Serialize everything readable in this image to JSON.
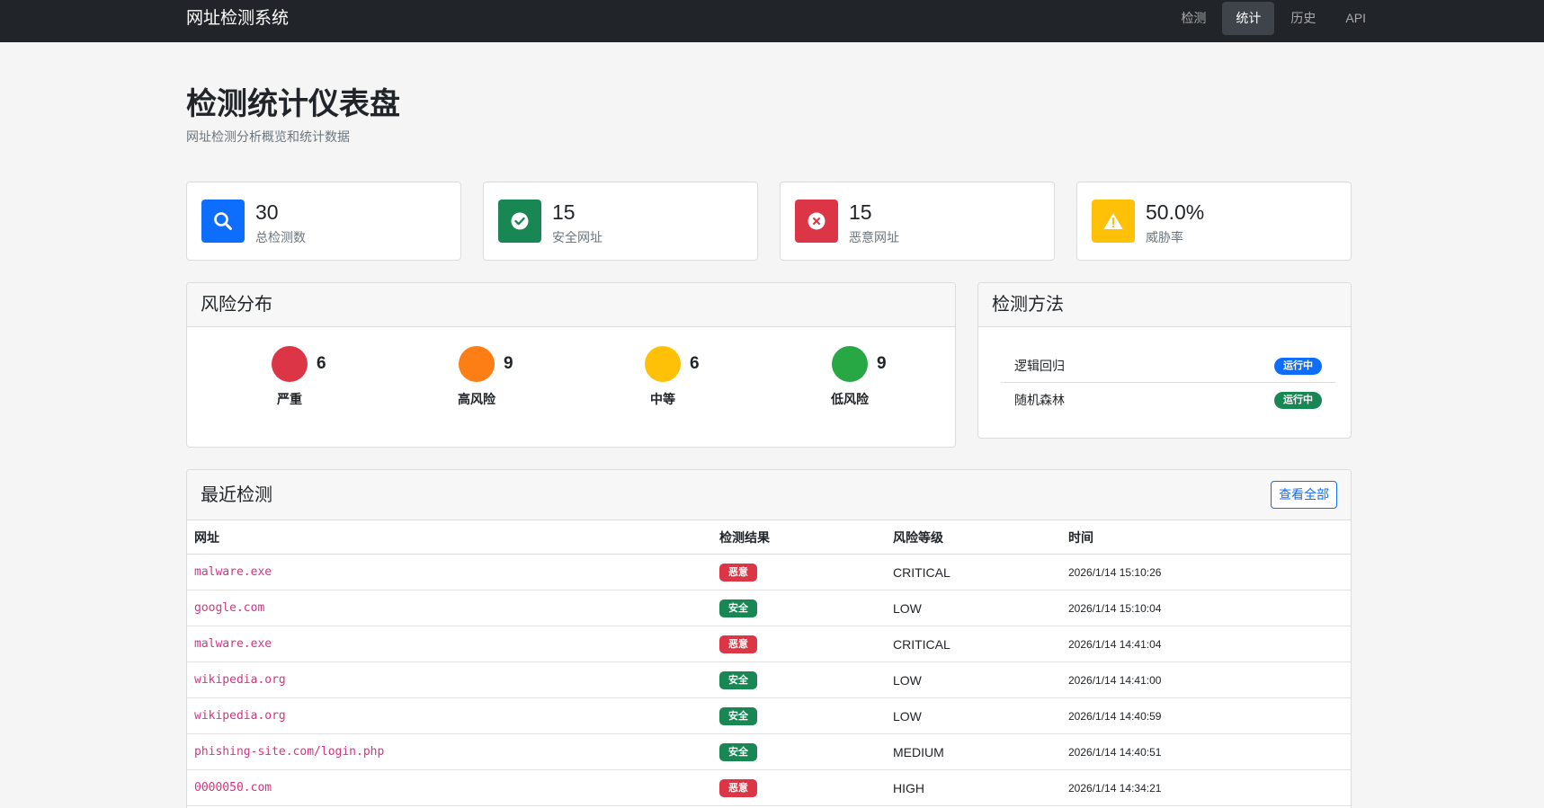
{
  "navbar": {
    "brand": "网址检测系统",
    "items": [
      {
        "label": "检测",
        "active": false
      },
      {
        "label": "统计",
        "active": true
      },
      {
        "label": "历史",
        "active": false
      },
      {
        "label": "API",
        "active": false
      }
    ]
  },
  "header": {
    "title": "检测统计仪表盘",
    "subtitle": "网址检测分析概览和统计数据"
  },
  "stats": [
    {
      "value": "30",
      "label": "总检测数",
      "icon": "search-icon",
      "color": "#0d6efd"
    },
    {
      "value": "15",
      "label": "安全网址",
      "icon": "check-circle-icon",
      "color": "#198754"
    },
    {
      "value": "15",
      "label": "恶意网址",
      "icon": "x-circle-icon",
      "color": "#dc3545"
    },
    {
      "value": "50.0%",
      "label": "威胁率",
      "icon": "warning-icon",
      "color": "#ffc107"
    }
  ],
  "risk": {
    "title": "风险分布",
    "items": [
      {
        "count": "6",
        "label": "严重",
        "color": "#dc3545"
      },
      {
        "count": "9",
        "label": "高风险",
        "color": "#fd7e14"
      },
      {
        "count": "6",
        "label": "中等",
        "color": "#ffc107"
      },
      {
        "count": "9",
        "label": "低风险",
        "color": "#28a745"
      }
    ]
  },
  "methods": {
    "title": "检测方法",
    "items": [
      {
        "name": "逻辑回归",
        "status": "运行中",
        "color": "#0d6efd"
      },
      {
        "name": "随机森林",
        "status": "运行中",
        "color": "#198754"
      }
    ]
  },
  "recent": {
    "title": "最近检测",
    "view_all": "查看全部",
    "columns": [
      "网址",
      "检测结果",
      "风险等级",
      "时间"
    ],
    "rows": [
      {
        "url": "malware.exe",
        "result": "恶意",
        "result_color": "#dc3545",
        "level": "CRITICAL",
        "time": "2026/1/14 15:10:26"
      },
      {
        "url": "google.com",
        "result": "安全",
        "result_color": "#198754",
        "level": "LOW",
        "time": "2026/1/14 15:10:04"
      },
      {
        "url": "malware.exe",
        "result": "恶意",
        "result_color": "#dc3545",
        "level": "CRITICAL",
        "time": "2026/1/14 14:41:04"
      },
      {
        "url": "wikipedia.org",
        "result": "安全",
        "result_color": "#198754",
        "level": "LOW",
        "time": "2026/1/14 14:41:00"
      },
      {
        "url": "wikipedia.org",
        "result": "安全",
        "result_color": "#198754",
        "level": "LOW",
        "time": "2026/1/14 14:40:59"
      },
      {
        "url": "phishing-site.com/login.php",
        "result": "安全",
        "result_color": "#198754",
        "level": "MEDIUM",
        "time": "2026/1/14 14:40:51"
      },
      {
        "url": "0000050.com",
        "result": "恶意",
        "result_color": "#dc3545",
        "level": "HIGH",
        "time": "2026/1/14 14:34:21"
      }
    ]
  }
}
